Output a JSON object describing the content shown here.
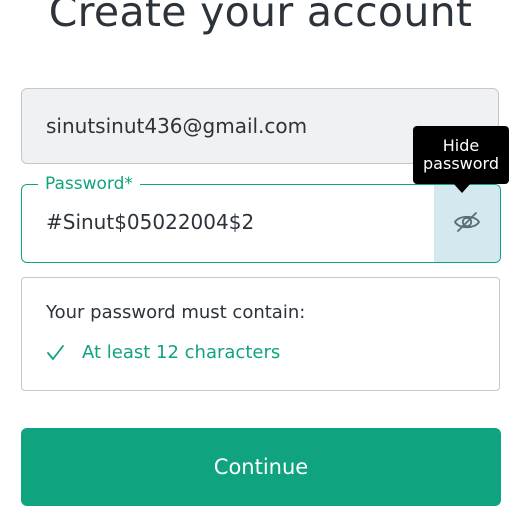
{
  "heading": "Create your account",
  "email": {
    "value": "sinutsinut436@gmail.com"
  },
  "password": {
    "label": "Password*",
    "value": "#Sinut$05022004$2",
    "toggle_icon": "eye-slash-icon",
    "tooltip_line1": "Hide",
    "tooltip_line2": "password"
  },
  "requirements": {
    "title": "Your password must contain:",
    "items": [
      {
        "label": "At least 12 characters",
        "met": true
      }
    ]
  },
  "continue_label": "Continue",
  "colors": {
    "accent": "#10a37f",
    "text": "#2d333a",
    "eye_button_bg": "#d4e8ef",
    "email_bg": "#f0f1f3",
    "tooltip_bg": "#000000"
  }
}
